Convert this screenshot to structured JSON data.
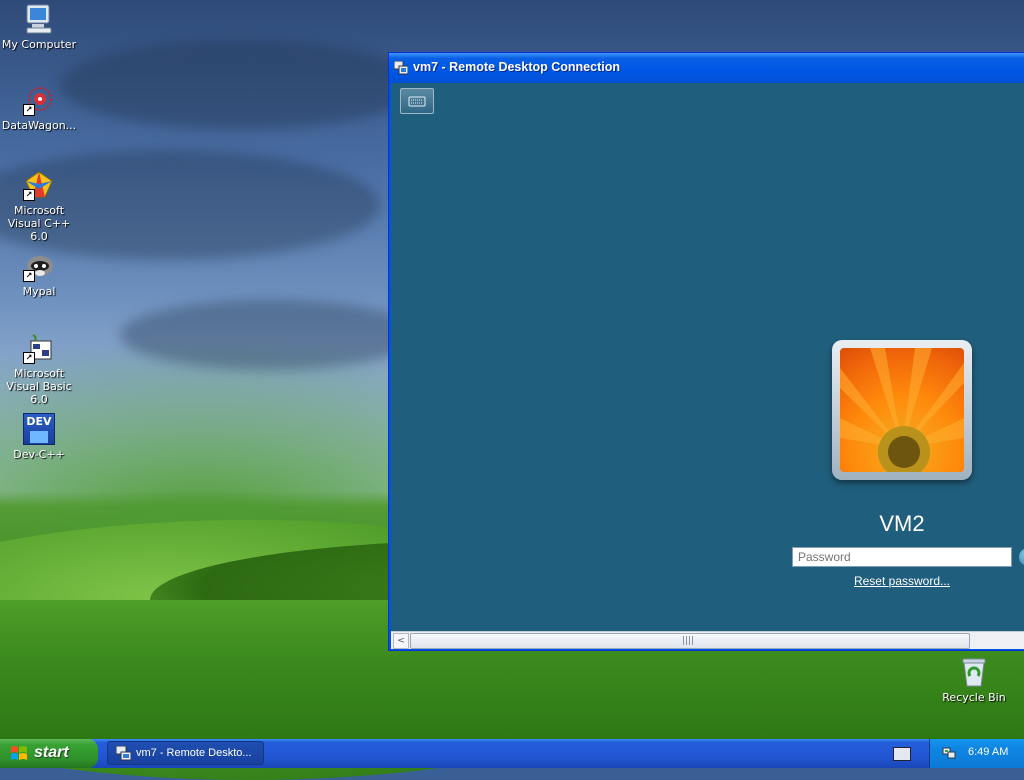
{
  "desktop": {
    "icons": [
      {
        "label": "My Computer"
      },
      {
        "label": "DataWagon..."
      },
      {
        "label": "Microsoft Visual C++ 6.0"
      },
      {
        "label": "Mypal"
      },
      {
        "label": "Microsoft Visual Basic 6.0"
      },
      {
        "label": "Dev-C++"
      },
      {
        "label": "Recycle Bin"
      }
    ],
    "dev_icon_text": "DEV"
  },
  "rdc_window": {
    "title": "vm7 - Remote Desktop Connection",
    "login": {
      "username": "VM2",
      "password_placeholder": "Password",
      "reset_link": "Reset password..."
    }
  },
  "taskbar": {
    "start_label": "start",
    "task_label": "vm7 - Remote Deskto...",
    "clock": "6:49 AM"
  },
  "colors": {
    "xp_blue": "#0055e5",
    "rdc_background": "#1f5e7c",
    "start_green": "#37a233"
  }
}
